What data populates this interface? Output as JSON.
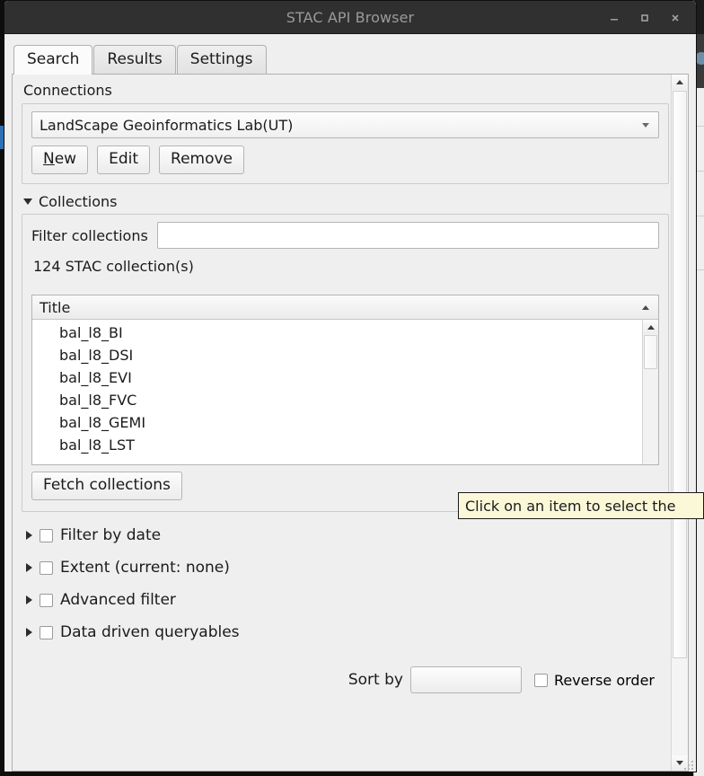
{
  "window": {
    "title": "STAC API Browser",
    "controls": {
      "minimize": "minimize-icon",
      "maximize": "maximize-icon",
      "close": "close-icon"
    }
  },
  "tabs": [
    {
      "label": "Search",
      "active": true
    },
    {
      "label": "Results",
      "active": false
    },
    {
      "label": "Settings",
      "active": false
    }
  ],
  "connections": {
    "group_label": "Connections",
    "selected": "LandScape Geoinformatics Lab(UT)",
    "buttons": {
      "new_accel": "N",
      "new_rest": "ew",
      "edit": "Edit",
      "remove": "Remove"
    }
  },
  "collections": {
    "section_label": "Collections",
    "expanded": true,
    "filter_label": "Filter collections",
    "filter_value": "",
    "filter_placeholder": "",
    "count_text": "124 STAC collection(s)",
    "list": {
      "column_header": "Title",
      "sort_direction": "ascending",
      "rows": [
        "bal_l8_BI",
        "bal_l8_DSI",
        "bal_l8_EVI",
        "bal_l8_FVC",
        "bal_l8_GEMI",
        "bal_l8_LST"
      ]
    },
    "fetch_button": "Fetch collections"
  },
  "options": [
    {
      "label": "Filter by date",
      "checked": false,
      "expanded": false
    },
    {
      "label": "Extent (current: none)",
      "checked": false,
      "expanded": false
    },
    {
      "label": "Advanced filter",
      "checked": false,
      "expanded": false
    },
    {
      "label": "Data driven queryables",
      "checked": false,
      "expanded": false
    }
  ],
  "sort": {
    "label": "Sort by",
    "value": "",
    "reverse_label": "Reverse order",
    "reverse_checked": false
  },
  "tooltip": {
    "text": "Click on an item to select the"
  },
  "colors": {
    "titlebar": "#303030",
    "titlebar_text": "#9a9a9a",
    "window_bg": "#efefef",
    "tooltip_bg": "#fbf8d8",
    "list_bg": "#ffffff",
    "text": "#1b1b1b"
  }
}
